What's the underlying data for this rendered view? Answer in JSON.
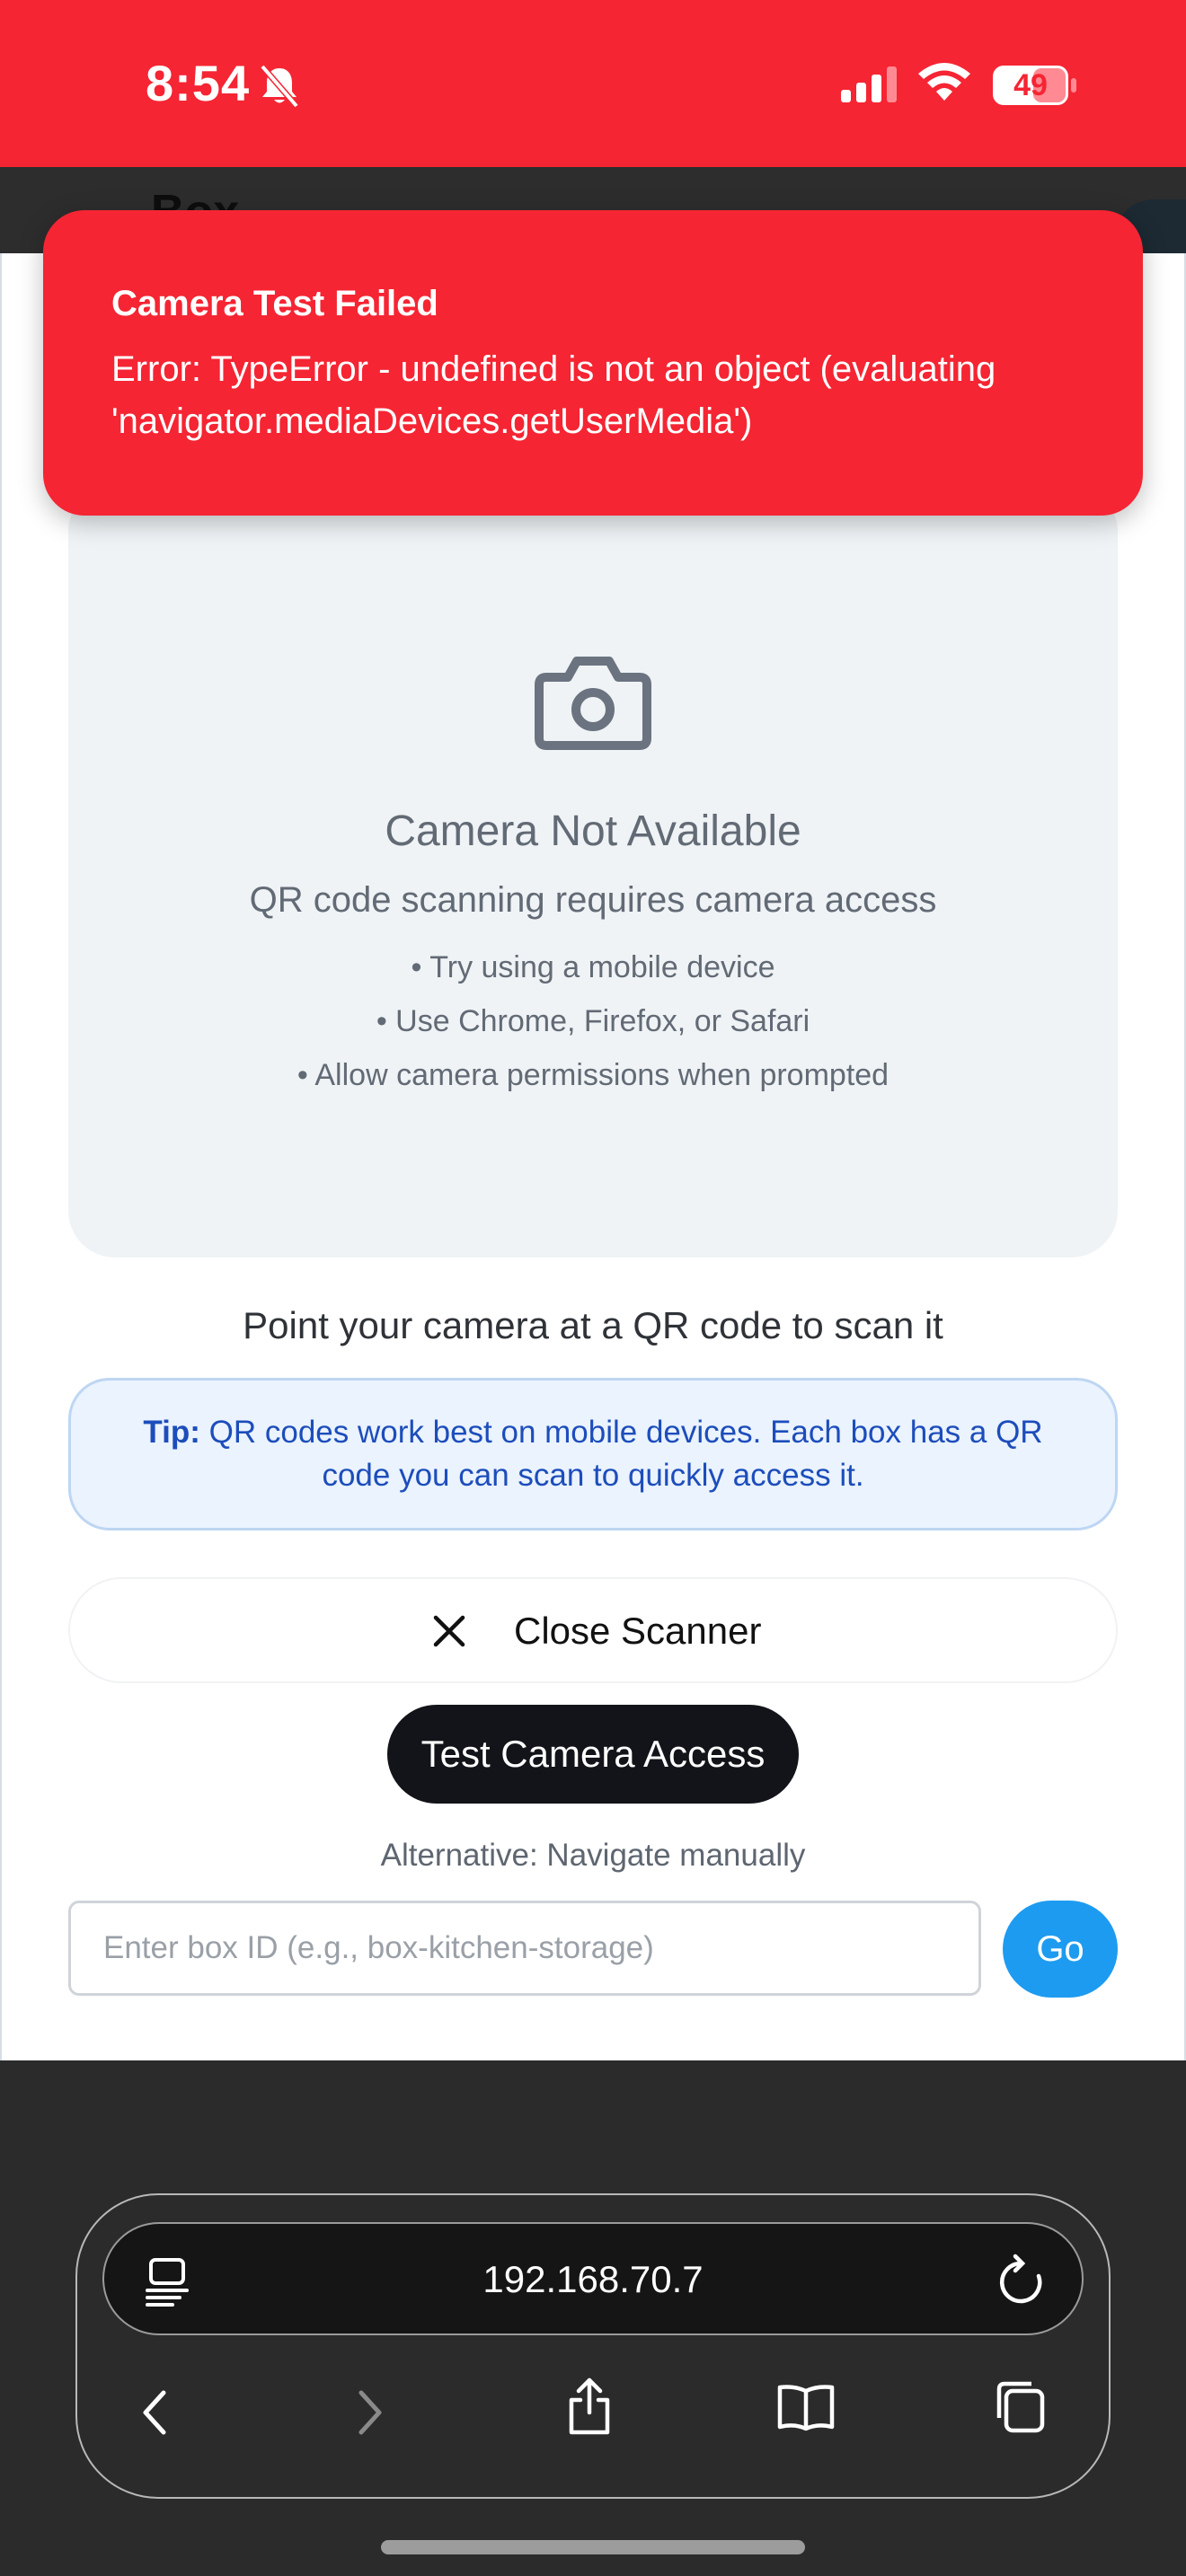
{
  "status_bar": {
    "time": "8:54",
    "battery": "49"
  },
  "page_header": {
    "title": "Box"
  },
  "toast": {
    "title": "Camera Test Failed",
    "message": "Error: TypeError - undefined is not an object (evaluating 'navigator.mediaDevices.getUserMedia')"
  },
  "camera": {
    "icon": "camera-icon",
    "title": "Camera Not Available",
    "subtitle": "QR code scanning requires camera access",
    "tips": [
      "• Try using a mobile device",
      "• Use Chrome, Firefox, or Safari",
      "• Allow camera permissions when prompted"
    ]
  },
  "instruction": "Point your camera at a QR code to scan it",
  "tip": {
    "label": "Tip:",
    "text": "QR codes work best on mobile devices. Each box has a QR code you can scan to quickly access it."
  },
  "buttons": {
    "close_scanner": "Close Scanner",
    "test_camera": "Test Camera Access",
    "go": "Go"
  },
  "alternative_label": "Alternative: Navigate manually",
  "box_input": {
    "placeholder": "Enter box ID (e.g., box-kitchen-storage)",
    "value": ""
  },
  "browser": {
    "url": "192.168.70.7"
  },
  "colors": {
    "accent_red": "#f52533",
    "go_blue": "#1d9bf0",
    "tip_text": "#1d4dbb"
  }
}
